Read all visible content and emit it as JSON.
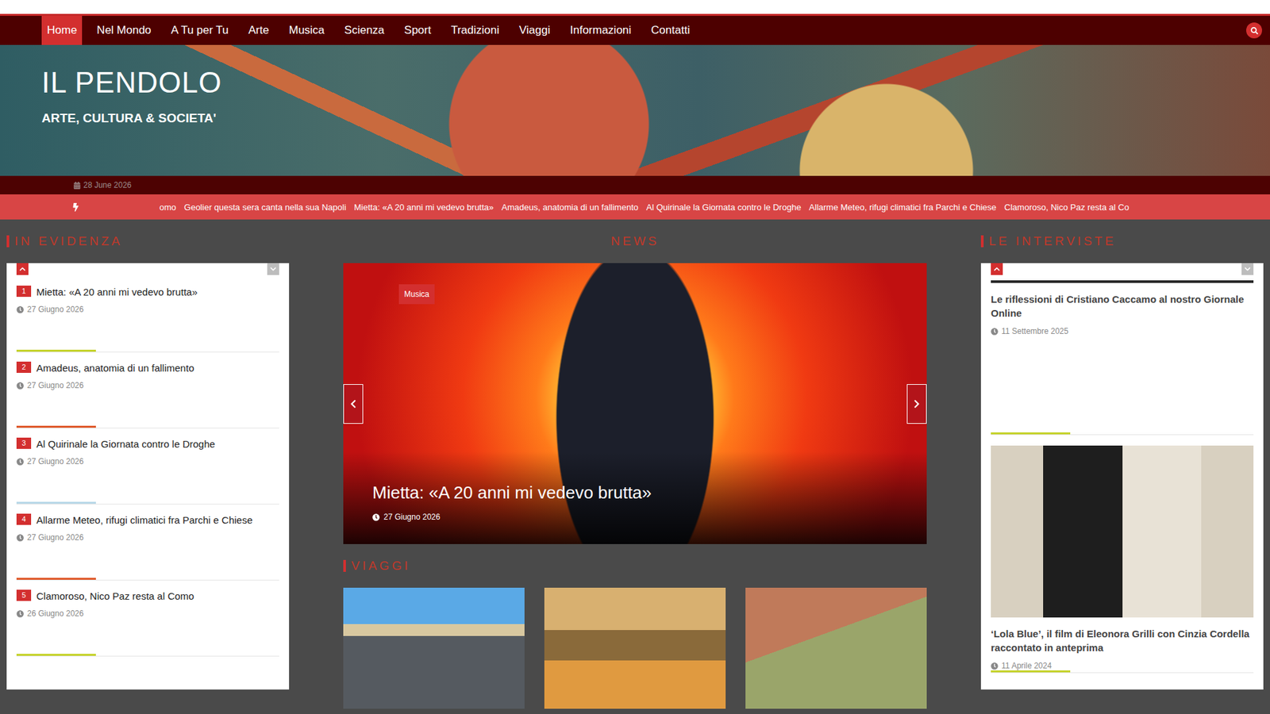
{
  "site": {
    "title": "IL PENDOLO",
    "tagline": "ARTE, CULTURA & SOCIETA'"
  },
  "nav": [
    {
      "label": "Home",
      "selected": true
    },
    {
      "label": "Nel Mondo",
      "selected": false
    },
    {
      "label": "A Tu per Tu",
      "selected": false
    },
    {
      "label": "Arte",
      "selected": false
    },
    {
      "label": "Musica",
      "selected": false
    },
    {
      "label": "Scienza",
      "selected": false
    },
    {
      "label": "Sport",
      "selected": false
    },
    {
      "label": "Tradizioni",
      "selected": false
    },
    {
      "label": "Viaggi",
      "selected": false
    },
    {
      "label": "Informazioni",
      "selected": false
    },
    {
      "label": "Contatti",
      "selected": false
    }
  ],
  "date": "28 June 2026",
  "ticker": [
    "omo",
    "Geolier questa sera canta nella sua Napoli",
    "Mietta: «A 20 anni mi vedevo brutta»",
    "Amadeus, anatomia di un fallimento",
    "Al Quirinale la Giornata contro le Droghe",
    "Allarme Meteo, rifugi climatici fra Parchi e Chiese",
    "Clamoroso, Nico Paz resta al Co"
  ],
  "in_evidenza": {
    "title": "IN EVIDENZA",
    "items": [
      {
        "rank": "1",
        "title": "Mietta: «A 20 anni mi vedevo brutta»",
        "date": "27 Giugno 2026",
        "color": "#c5d32b"
      },
      {
        "rank": "2",
        "title": "Amadeus, anatomia di un fallimento",
        "date": "27 Giugno 2026",
        "color": "#e05a2b"
      },
      {
        "rank": "3",
        "title": "Al Quirinale la Giornata contro le Droghe",
        "date": "27 Giugno 2026",
        "color": "#b8d8e8"
      },
      {
        "rank": "4",
        "title": "Allarme Meteo, rifugi climatici fra Parchi e Chiese",
        "date": "27 Giugno 2026",
        "color": "#e05a2b"
      },
      {
        "rank": "5",
        "title": "Clamoroso, Nico Paz resta al Como",
        "date": "26 Giugno 2026",
        "color": "#c5d32b"
      }
    ]
  },
  "news": {
    "title": "NEWS",
    "slide": {
      "category": "Musica",
      "title": "Mietta: «A 20 anni mi vedevo brutta»",
      "date": "27 Giugno 2026"
    }
  },
  "viaggi": {
    "title": "VIAGGI"
  },
  "interviste": {
    "title": "LE INTERVISTE",
    "items": [
      {
        "title": "Le riflessioni di Cristiano Caccamo al nostro Giornale Online",
        "date": "11 Settembre 2025",
        "color": "#c5d32b"
      },
      {
        "title": "‘Lola Blue’, il film di Eleonora Grilli con Cinzia Cordella raccontato in anteprima",
        "date": "11 Aprile 2024",
        "color": "#c5d32b"
      }
    ]
  }
}
